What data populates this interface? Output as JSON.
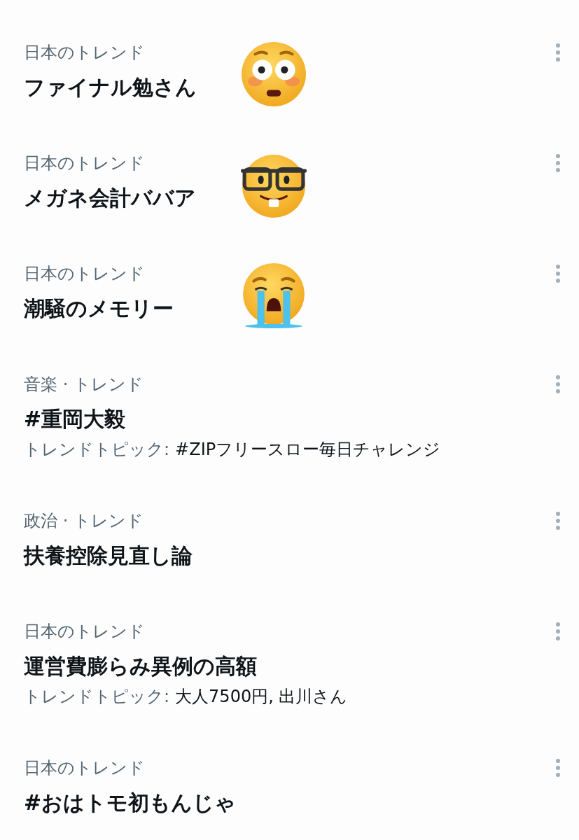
{
  "trends": [
    {
      "category": "日本のトレンド",
      "title": "ファイナル勉さん",
      "kind": "flushed"
    },
    {
      "category": "日本のトレンド",
      "title": "メガネ会計ババア",
      "kind": "nerd"
    },
    {
      "category": "日本のトレンド",
      "title": "潮騒のメモリー",
      "kind": "crying"
    },
    {
      "category": "音楽 · トレンド",
      "title": "#重岡大毅",
      "topic_label": "トレンドトピック:",
      "topic": "#ZIPフリースロー毎日チャレンジ"
    },
    {
      "category": "政治 · トレンド",
      "title": "扶養控除見直し論"
    },
    {
      "category": "日本のトレンド",
      "title": "運営費膨らみ異例の高額",
      "topic_label": "トレンドトピック:",
      "topic": "大人7500円, 出川さん"
    },
    {
      "category": "日本のトレンド",
      "title": "#おはトモ初もんじゃ"
    }
  ]
}
